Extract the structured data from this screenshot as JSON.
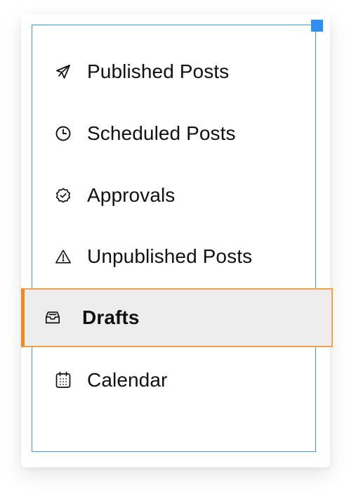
{
  "menu": {
    "items": [
      {
        "label": "Published Posts",
        "icon": "paper-plane-icon"
      },
      {
        "label": "Scheduled Posts",
        "icon": "clock-icon"
      },
      {
        "label": "Approvals",
        "icon": "badge-check-icon"
      },
      {
        "label": "Unpublished Posts",
        "icon": "warning-triangle-icon"
      },
      {
        "label": "Drafts",
        "icon": "inbox-tray-icon",
        "active": true
      },
      {
        "label": "Calendar",
        "icon": "calendar-icon"
      }
    ]
  },
  "colors": {
    "panel_border": "#3d9be0",
    "resize_handle": "#2f8ff0",
    "active_background": "#ededed",
    "active_border": "#f08a1e",
    "text": "#111111"
  }
}
